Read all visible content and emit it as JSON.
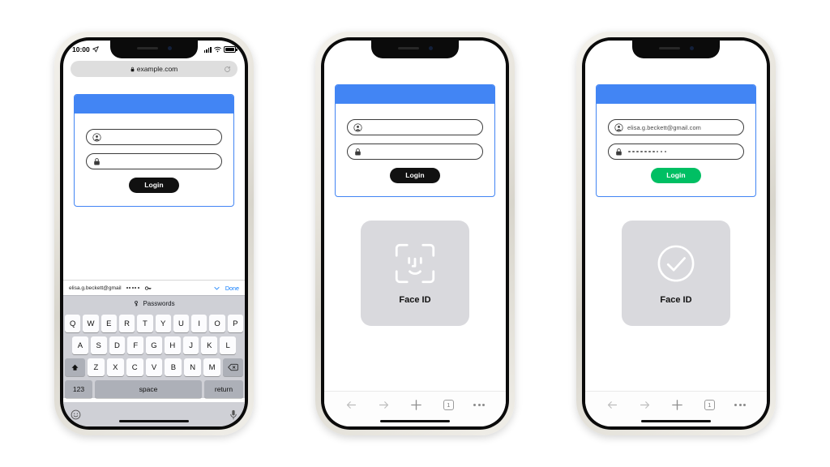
{
  "scene": {
    "title": "Face ID web login autofill flow on iPhone",
    "background": "#ffffff",
    "accent_blue": "#4285F4",
    "accent_green": "#00BF63",
    "button_dark": "#111111",
    "sheet_gray": "#d9d9dd"
  },
  "status_bar": {
    "time": "10:00",
    "location_icon": "location-arrow-icon",
    "signal_icon": "cellular-bars-icon",
    "wifi_icon": "wifi-icon",
    "battery_icon": "battery-icon"
  },
  "url_bar": {
    "lock_icon": "lock-icon",
    "url": "example.com",
    "reload_icon": "reload-icon"
  },
  "login_card": {
    "username_icon": "person-icon",
    "password_icon": "lock-icon",
    "username_empty": "",
    "password_empty": "",
    "username_filled": "elisa.g.beckett@gmail.com",
    "password_masked_dots": 10,
    "login_label": "Login"
  },
  "autofill_bar": {
    "suggestion_email": "elisa.g.beckett@gmail",
    "suggestion_dots": 5,
    "key_icon": "key-icon",
    "chevron_icon": "chevron-down-icon",
    "done_label": "Done"
  },
  "passwords_bar": {
    "key_icon": "key-icon",
    "label": "Passwords"
  },
  "keyboard": {
    "row1": [
      "Q",
      "W",
      "E",
      "R",
      "T",
      "Y",
      "U",
      "I",
      "O",
      "P"
    ],
    "row2": [
      "A",
      "S",
      "D",
      "F",
      "G",
      "H",
      "J",
      "K",
      "L"
    ],
    "row3_shift": "shift-icon",
    "row3": [
      "Z",
      "X",
      "C",
      "V",
      "B",
      "N",
      "M"
    ],
    "row3_backspace": "backspace-icon",
    "numbers_label": "123",
    "space_label": "space",
    "return_label": "return",
    "emoji_icon": "emoji-smiley-icon",
    "mic_icon": "microphone-icon"
  },
  "browser_toolbar": {
    "back_icon": "arrow-back-icon",
    "forward_icon": "arrow-forward-icon",
    "new_tab_icon": "plus-icon",
    "tab_count": "1",
    "more_icon": "more-ellipsis-icon"
  },
  "face_id": {
    "scan_icon": "face-id-scan-icon",
    "success_icon": "checkmark-circle-icon",
    "label": "Face ID"
  },
  "phones": [
    {
      "id": "phone-1",
      "caption_state": "keyboard-with-password-autofill",
      "shows_status_bar": true,
      "shows_url_bar": true,
      "shows_keyboard": true,
      "shows_face_id": false,
      "shows_browser_toolbar": false,
      "login_button_color": "#111111",
      "fields_filled": false
    },
    {
      "id": "phone-2",
      "caption_state": "face-id-scanning",
      "shows_status_bar": false,
      "shows_url_bar": false,
      "shows_keyboard": false,
      "shows_face_id": true,
      "face_id_variant": "scan",
      "shows_browser_toolbar": true,
      "login_button_color": "#111111",
      "fields_filled": false
    },
    {
      "id": "phone-3",
      "caption_state": "face-id-success-credentials-filled",
      "shows_status_bar": false,
      "shows_url_bar": false,
      "shows_keyboard": false,
      "shows_face_id": true,
      "face_id_variant": "success",
      "shows_browser_toolbar": true,
      "login_button_color": "#00BF63",
      "fields_filled": true
    }
  ]
}
